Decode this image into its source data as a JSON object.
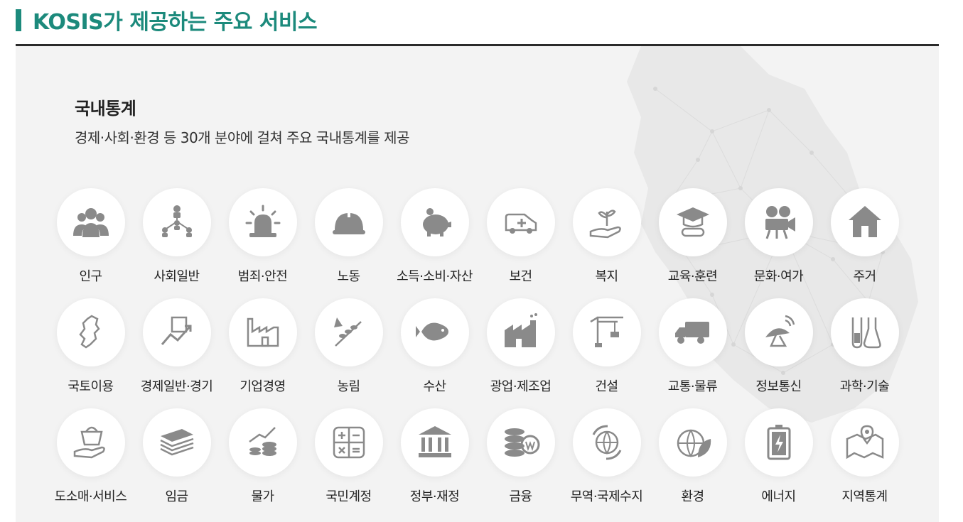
{
  "header": {
    "title": "KOSIS가 제공하는 주요 서비스"
  },
  "section": {
    "title": "국내통계",
    "description": "경제·사회·환경 등 30개 분야에 걸쳐 주요 국내통계를 제공"
  },
  "colors": {
    "accent": "#1c8a7c",
    "icon": "#8a8a8a",
    "panel": "#f3f3f3"
  },
  "categories": [
    {
      "label": "인구",
      "icon": "people-icon"
    },
    {
      "label": "사회일반",
      "icon": "org-chart-icon"
    },
    {
      "label": "범죄·안전",
      "icon": "siren-icon"
    },
    {
      "label": "노동",
      "icon": "hard-hat-icon"
    },
    {
      "label": "소득·소비·자산",
      "icon": "piggy-bank-icon"
    },
    {
      "label": "보건",
      "icon": "ambulance-icon"
    },
    {
      "label": "복지",
      "icon": "hand-plant-icon"
    },
    {
      "label": "교육·훈련",
      "icon": "graduation-icon"
    },
    {
      "label": "문화·여가",
      "icon": "film-camera-icon"
    },
    {
      "label": "주거",
      "icon": "house-icon"
    },
    {
      "label": "국토이용",
      "icon": "korea-map-icon"
    },
    {
      "label": "경제일반·경기",
      "icon": "growth-chart-icon"
    },
    {
      "label": "기업경영",
      "icon": "factory-outline-icon"
    },
    {
      "label": "농림",
      "icon": "wheat-icon"
    },
    {
      "label": "수산",
      "icon": "fish-icon"
    },
    {
      "label": "광업·제조업",
      "icon": "factory-icon"
    },
    {
      "label": "건설",
      "icon": "crane-icon"
    },
    {
      "label": "교통·물류",
      "icon": "truck-icon"
    },
    {
      "label": "정보통신",
      "icon": "satellite-dish-icon"
    },
    {
      "label": "과학·기술",
      "icon": "flask-icon"
    },
    {
      "label": "도소매·서비스",
      "icon": "basket-hand-icon"
    },
    {
      "label": "임금",
      "icon": "money-stack-icon"
    },
    {
      "label": "물가",
      "icon": "coins-chart-icon"
    },
    {
      "label": "국민계정",
      "icon": "calculator-icon"
    },
    {
      "label": "정부·재정",
      "icon": "government-icon"
    },
    {
      "label": "금융",
      "icon": "won-coins-icon"
    },
    {
      "label": "무역·국제수지",
      "icon": "globe-trade-icon"
    },
    {
      "label": "환경",
      "icon": "globe-leaf-icon"
    },
    {
      "label": "에너지",
      "icon": "battery-icon"
    },
    {
      "label": "지역통계",
      "icon": "map-pin-icon"
    }
  ]
}
